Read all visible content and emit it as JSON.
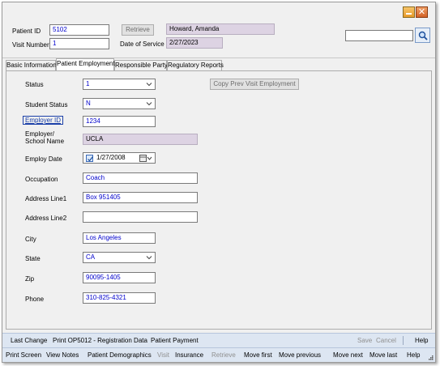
{
  "window": {
    "controls": {
      "minimize_icon": "minimize-icon",
      "close_symbol": "✕"
    }
  },
  "header": {
    "patient_id_label": "Patient ID",
    "patient_id_value": "5102",
    "retrieve_button": "Retrieve",
    "patient_name": "Howard, Amanda",
    "visit_number_label": "Visit Number",
    "visit_number_value": "1",
    "date_of_service_label": "Date of Service",
    "date_of_service_value": "2/27/2023",
    "search_value": "",
    "search_icon": "magnifier-icon"
  },
  "tabs": [
    {
      "label": "Basic Information",
      "active": false
    },
    {
      "label": "Patient Employment",
      "active": true
    },
    {
      "label": "Responsible Party",
      "active": false
    },
    {
      "label": "Regulatory Reports",
      "active": false
    }
  ],
  "form": {
    "copy_prev_button": "Copy Prev Visit Employment",
    "status": {
      "label": "Status",
      "value": "1"
    },
    "student_status": {
      "label": "Student Status",
      "value": "N"
    },
    "employer_id": {
      "label": "Employer ID",
      "value": "1234"
    },
    "employer_name": {
      "label_line1": "Employer/",
      "label_line2": "School Name",
      "value": "UCLA"
    },
    "employ_date": {
      "label": "Employ Date",
      "value": "1/27/2008",
      "checked": true
    },
    "occupation": {
      "label": "Occupation",
      "value": "Coach"
    },
    "address1": {
      "label": "Address Line1",
      "value": "Box 951405"
    },
    "address2": {
      "label": "Address Line2",
      "value": ""
    },
    "city": {
      "label": "City",
      "value": "Los Angeles"
    },
    "state": {
      "label": "State",
      "value": "CA"
    },
    "zip": {
      "label": "Zip",
      "value": "90095-1405"
    },
    "phone": {
      "label": "Phone",
      "value": "310-825-4321"
    }
  },
  "bottom_bar_1": {
    "last_change": "Last Change",
    "print_op5012": "Print OP5012 - Registration Data",
    "patient_payment": "Patient Payment",
    "save": "Save",
    "cancel": "Cancel",
    "help": "Help"
  },
  "bottom_bar_2": {
    "print_screen": "Print Screen",
    "view_notes": "View Notes",
    "patient_demographics": "Patient Demographics",
    "visit": "Visit",
    "insurance": "Insurance",
    "retrieve": "Retrieve",
    "move_first": "Move first",
    "move_previous": "Move previous",
    "move_next": "Move next",
    "move_last": "Move last",
    "help": "Help"
  },
  "colors": {
    "field_text": "#0000cc",
    "readonly_bg": "#ddd3e3",
    "toolbar_bg": "#dde6f2",
    "disabled_text": "#8f8f8f"
  }
}
